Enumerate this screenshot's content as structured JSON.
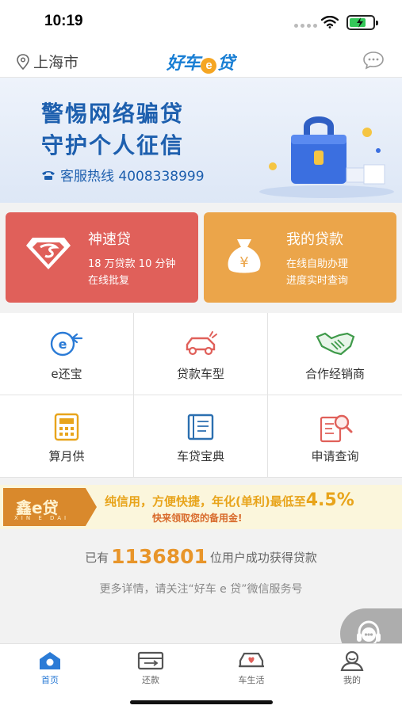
{
  "status_bar": {
    "time": "10:19"
  },
  "header": {
    "location": "上海市",
    "logo_parts": [
      "好车",
      "e",
      "贷"
    ]
  },
  "banner": {
    "line1": "警惕网络骗贷",
    "line2": "守护个人征信",
    "hotline": "客服热线 4008338999"
  },
  "cards": [
    {
      "title": "神速贷",
      "sub1": "18 万贷款 10 分钟",
      "sub2": "在线批复",
      "color": "#e0605a"
    },
    {
      "title": "我的贷款",
      "sub1": "在线自助办理",
      "sub2": "进度实时查询",
      "color": "#eba54a"
    }
  ],
  "grid": [
    {
      "label": "e还宝",
      "icon": "e-repay-icon"
    },
    {
      "label": "贷款车型",
      "icon": "car-icon"
    },
    {
      "label": "合作经销商",
      "icon": "handshake-icon"
    },
    {
      "label": "算月供",
      "icon": "calculator-icon"
    },
    {
      "label": "车贷宝典",
      "icon": "book-icon"
    },
    {
      "label": "申请查询",
      "icon": "search-document-icon"
    }
  ],
  "promo": {
    "brand": "鑫e贷",
    "brand_sub": "XIN E DAI",
    "line1_prefix": "纯信用，方便快捷，年化(单利)最低至",
    "rate": "4.5%",
    "line2": "快来领取您的备用金!"
  },
  "stats": {
    "prefix": "已有",
    "count": "1136801",
    "suffix": "位用户成功获得贷款",
    "follow": "更多详情，请关注“好车 e 贷”微信服务号"
  },
  "tabs": [
    {
      "label": "首页",
      "active": true
    },
    {
      "label": "还款",
      "active": false
    },
    {
      "label": "车生活",
      "active": false
    },
    {
      "label": "我的",
      "active": false
    }
  ],
  "colors": {
    "brand_blue": "#2b7bd6",
    "red_card": "#e0605a",
    "orange_card": "#eba54a",
    "accent_orange": "#e8952a"
  }
}
